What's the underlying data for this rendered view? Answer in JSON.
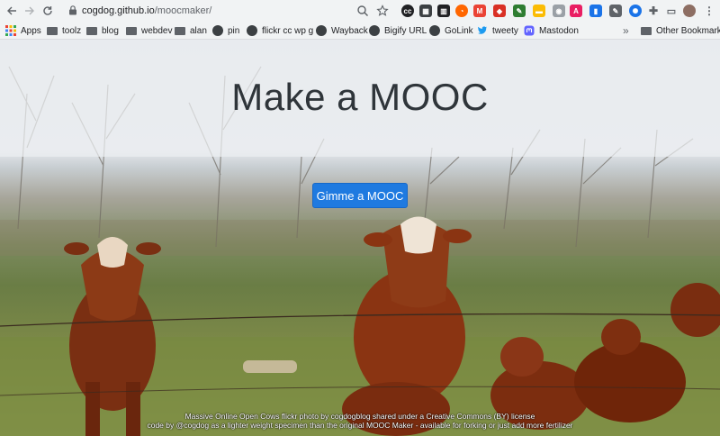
{
  "browser": {
    "url_host": "cogdog.github.io",
    "url_path": "/moocmaker/",
    "bookmarks": [
      {
        "label": "Apps",
        "icon": "apps-grid-icon"
      },
      {
        "label": "toolz",
        "icon": "folder-icon"
      },
      {
        "label": "blog",
        "icon": "folder-icon"
      },
      {
        "label": "webdev",
        "icon": "folder-icon"
      },
      {
        "label": "alan",
        "icon": "folder-icon"
      },
      {
        "label": "pin",
        "icon": "globe-icon"
      },
      {
        "label": "flickr cc wp g",
        "icon": "globe-icon"
      },
      {
        "label": "Wayback",
        "icon": "globe-icon"
      },
      {
        "label": "Bigify URL",
        "icon": "globe-icon"
      },
      {
        "label": "GoLink",
        "icon": "globe-icon"
      },
      {
        "label": "tweety",
        "icon": "twitter-icon"
      },
      {
        "label": "Mastodon",
        "icon": "mastodon-icon"
      }
    ],
    "overflow": "»",
    "other_bookmarks": "Other Bookmarks"
  },
  "page": {
    "title": "Make a MOOC",
    "button_label": "Gimme a MOOC",
    "credit_line_1": "Massive Online Open Cows flickr photo by cogdogblog shared under a Creative Commons (BY) license",
    "credit_line_2": "code by @cogdog as a lighter weight specimen than the original MOOC Maker - available for forking or just add more fertilizer"
  },
  "colors": {
    "button": "#1f7ae0",
    "title": "#2f353a",
    "chrome": "#f1f3f4"
  }
}
